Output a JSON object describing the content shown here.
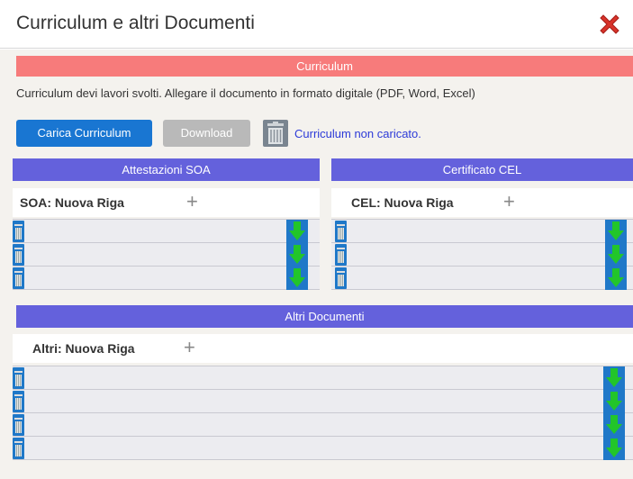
{
  "window": {
    "title": "Curriculum e altri Documenti"
  },
  "curriculum": {
    "header": "Curriculum",
    "description": "Curriculum devi lavori svolti. Allegare il documento in formato digitale (PDF, Word, Excel)",
    "upload_label": "Carica Curriculum",
    "download_label": "Download",
    "status": "Curriculum non caricato."
  },
  "soa": {
    "header": "Attestazioni SOA",
    "add_label": "SOA: Nuova Riga",
    "plus": "+",
    "rows": 3
  },
  "cel": {
    "header": "Certificato CEL",
    "add_label": "CEL: Nuova Riga",
    "plus": "+",
    "rows": 3
  },
  "altri": {
    "header": "Altri Documenti",
    "add_label": "Altri: Nuova Riga",
    "plus": "+",
    "rows": 4
  },
  "colors": {
    "red_banner": "#f77b7b",
    "section_bar": "#6461dc",
    "primary_button": "#1976d2",
    "disabled_button": "#b9b9b9",
    "status_text": "#2d3bd8",
    "download_arrow": "#22c52a"
  }
}
